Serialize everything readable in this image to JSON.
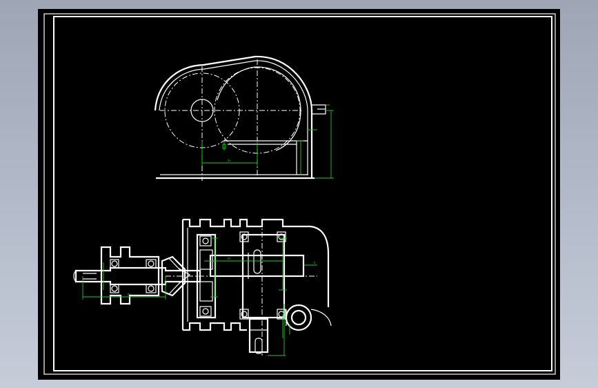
{
  "drawing": {
    "background": "#000000",
    "line_color": "#ffffff",
    "dimension_color": "#18d018"
  }
}
